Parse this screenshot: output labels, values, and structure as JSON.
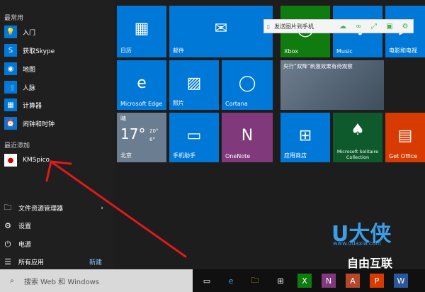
{
  "start": {
    "most_used_label": "最常用",
    "recent_label": "最近添加",
    "most_used": [
      {
        "label": "入门",
        "icon": "lightbulb-icon",
        "glyph": "💡"
      },
      {
        "label": "获取Skype",
        "icon": "skype-icon",
        "glyph": "S"
      },
      {
        "label": "地图",
        "icon": "maps-icon",
        "glyph": "◉"
      },
      {
        "label": "人脉",
        "icon": "people-icon",
        "glyph": "👥"
      },
      {
        "label": "计算器",
        "icon": "calculator-icon",
        "glyph": "▦"
      },
      {
        "label": "闹钟和时钟",
        "icon": "alarm-icon",
        "glyph": "⏰"
      }
    ],
    "recent": [
      {
        "label": "KMSpico",
        "icon": "kmspico-icon",
        "glyph": "●"
      }
    ],
    "bottom": [
      {
        "label": "文件资源管理器",
        "icon": "folder-icon",
        "glyph": "🗀"
      },
      {
        "label": "设置",
        "icon": "gear-icon",
        "glyph": "⚙"
      },
      {
        "label": "电源",
        "icon": "power-icon",
        "glyph": "⏻"
      },
      {
        "label": "所有应用",
        "icon": "all-apps-icon",
        "glyph": "☰"
      }
    ],
    "new_badge": "新建"
  },
  "tiles": {
    "calendar": "日历",
    "mail": "邮件",
    "xbox": "Xbox",
    "music": "Music",
    "movies": "电影和电视",
    "edge": "Microsoft Edge",
    "photos": "照片",
    "cortana": "Cortana",
    "news_text": "央行“双降”刺激效果有待观察",
    "weather_city": "北京",
    "weather_cond": "晴",
    "weather_temp": "17°",
    "weather_hi": "20°",
    "weather_lo": "6°",
    "phone": "手机助手",
    "onenote": "OneNote",
    "store": "应用商店",
    "solitaire": "Microsoft Solitaire Collection",
    "office": "Get Office"
  },
  "popup": {
    "label": "发送图片到手机"
  },
  "taskbar": {
    "search_placeholder": "搜索 Web 和 Windows"
  },
  "watermark": {
    "brand": "U大侠",
    "url": "www.udaxia.com",
    "sub": "自由互联"
  },
  "colors": {
    "tile_blue": "#0078d7",
    "green": "#107c10",
    "purple": "#5c2d91",
    "orange": "#d83b01",
    "red_arrow": "#e0191b"
  }
}
